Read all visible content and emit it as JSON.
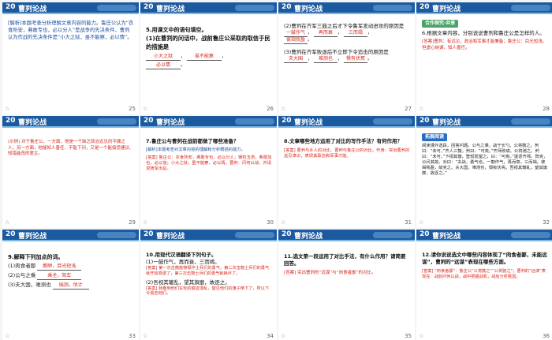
{
  "colors": {
    "header": "#1c5aa0",
    "accent": "#7fb8e8",
    "red": "#d8261c"
  },
  "slides": [
    {
      "num": "20",
      "title": "曹刿论战",
      "page": "25",
      "lead": "[解析]本题考查分析理解文意内容的能力。鲁庄公认为“衣食所安，弗敢专也，必以分人”是战争的先决条件，曹刿认为作战的先决条件是“小大之狱，虽不能察，必以情”。"
    },
    {
      "num": "20",
      "title": "曹刿论战",
      "page": "26",
      "q1": "5.用课文中的语句填空。",
      "q2": "(1)在曹刿的问话中，战前鲁庄公采取的取信于民的措施是",
      "a1": "小大之狱",
      "a2": "虽不能察",
      "a3": "必以情"
    },
    {
      "num": "20",
      "title": "曹刿论战",
      "page": "27",
      "q2": "(2)曹刿在齐军三鼓之后才下令鲁军发动进攻的原因是",
      "a1": "一鼓作气",
      "a2": "再而衰",
      "a3": "三而竭",
      "a4": "彼竭我盈",
      "q3": "(3)曹刿在齐军败退后不立即下令追击的原因是",
      "b1": "夫大国",
      "b2": "难测也",
      "b3": "惧有伏焉"
    },
    {
      "num": "20",
      "title": "曹刿论战",
      "page": "28",
      "tag": "合作探究·共享",
      "q": "6.根据文章内容，分别说说曹刿和鲁庄公是怎样的人。",
      "ans": "[答案]曹刿：有远见，政治和军事才能兼备；鲁庄公：目光短浅，但虚心纳谏，知人善任。"
    },
    {
      "num": "20",
      "title": "曹刿论战",
      "page": "29",
      "ans": "(示例) 对于鲁庄公，一方面，他是一个缺乏政治远见的平庸之人；另一方面，他能知人善任、不耻下问，又是一个能接受建议、知错能改的君主。"
    },
    {
      "num": "20",
      "title": "曹刿论战",
      "page": "30",
      "q": "7.鲁庄公与曹刿在战前都做了哪些准备？",
      "note": "[解析]本题考查对文章内容的理解和分析概括的能力。",
      "ans": "[答案] 鲁庄公：衣食所安，弗敢专也，必以分人；牺牲玉帛，弗敢加也，必以信；小大之狱，虽不能察，必以情。曹刿：问何以战，并请求随军出征。"
    },
    {
      "num": "20",
      "title": "曹刿论战",
      "page": "31",
      "q": "8.文章哪些地方运用了对比的写作手法？有何作用？",
      "ans": "[答案] 曹刿与乡人的对比、曹刿与鲁庄公的对比。作用：突出曹刿的远见卓识，表现其政治和军事才能。"
    },
    {
      "num": "20",
      "title": "曹刿论战",
      "page": "32",
      "tag": "拓展阅读",
      "ans": "阅读课外选段，回答问题。公与之乘，战于长勺。公将鼓之。刿曰：“未可。”齐人三鼓。刿曰：“可矣。”齐师败绩。公将驰之。刿曰：“未可。”下视其辙，登轼而望之，曰：“可矣。”遂逐齐师。既克，公问其故。对曰：“夫战，勇气也。一鼓作气，再而衰，三而竭。彼竭我盈，故克之。夫大国，难测也，惧有伏焉。吾视其辙乱，望其旗靡，故逐之。”"
    },
    {
      "num": "20",
      "title": "曹刿论战",
      "page": "33",
      "q": "9.解释下列加点的词。",
      "i1": "(1)肉食者鄙",
      "a1": "鄙陋，目光短浅",
      "i2": "(2)公与之乘",
      "a2": "乘坐，驾车",
      "i3": "(3)夫大国，难测也",
      "a3": "揣测，估计"
    },
    {
      "num": "20",
      "title": "曹刿论战",
      "page": "34",
      "q": "10.用现代汉语翻译下列句子。",
      "s1": "(1)一鼓作气，再而衰，三而竭。",
      "ans1": "[答案] 第一次击鼓能够振作士兵们的勇气，第二次击鼓士兵们的勇气就开始衰退了，第三次击鼓士兵们的勇气就耗尽了。",
      "s2": "(2)吾视其辙乱，望其旗靡，故逐之。",
      "ans2": "[答案] 我看到他们车轮的痕迹混乱，望见他们的旗子倒下了，所以下令追击他们。"
    },
    {
      "num": "20",
      "title": "曹刿论战",
      "page": "35",
      "q": "11.选文第一段运用了对比手法，有什么作用？请简要回答。",
      "ans": "[答案] 突出曹刿的“远谋”与“肉食者鄙”的对比。"
    },
    {
      "num": "20",
      "title": "曹刿论战",
      "page": "36",
      "q": "12.请你说说选文中哪些内容体现了“肉食者鄙，未能远谋”，曹刿的“远谋”表现在哪些方面。",
      "ans": "[答案] “肉食者鄙”：鲁庄公“公将鼓之”“公将驰之”；曹刿的“远谋”表现在：战前问何以战，战中把握战机，战后分析胜因。"
    }
  ]
}
